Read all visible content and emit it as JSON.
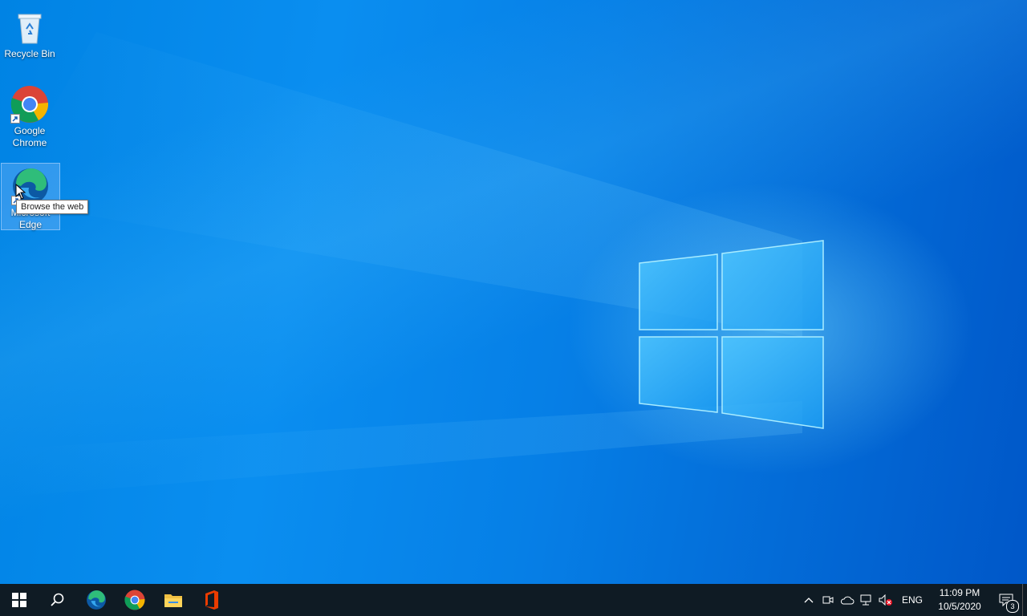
{
  "desktop": {
    "icons": [
      {
        "label": "Recycle Bin",
        "icon": "recycle-bin-icon"
      },
      {
        "label": "Google\nChrome",
        "icon": "chrome-icon"
      },
      {
        "label": "Microsoft\nEdge",
        "icon": "edge-icon"
      }
    ],
    "tooltip": "Browse the web"
  },
  "taskbar": {
    "pinned": [
      {
        "name": "start",
        "icon": "windows-start-icon"
      },
      {
        "name": "search",
        "icon": "search-icon"
      },
      {
        "name": "edge",
        "icon": "edge-icon"
      },
      {
        "name": "chrome",
        "icon": "chrome-icon"
      },
      {
        "name": "file-explorer",
        "icon": "folder-icon"
      },
      {
        "name": "office",
        "icon": "office-icon"
      }
    ],
    "tray": {
      "language": "ENG",
      "time": "11:09 PM",
      "date": "10/5/2020",
      "notification_count": "3"
    }
  },
  "colors": {
    "taskbar_bg": "#0f1b24",
    "desktop_accent": "#0a8ef0"
  }
}
